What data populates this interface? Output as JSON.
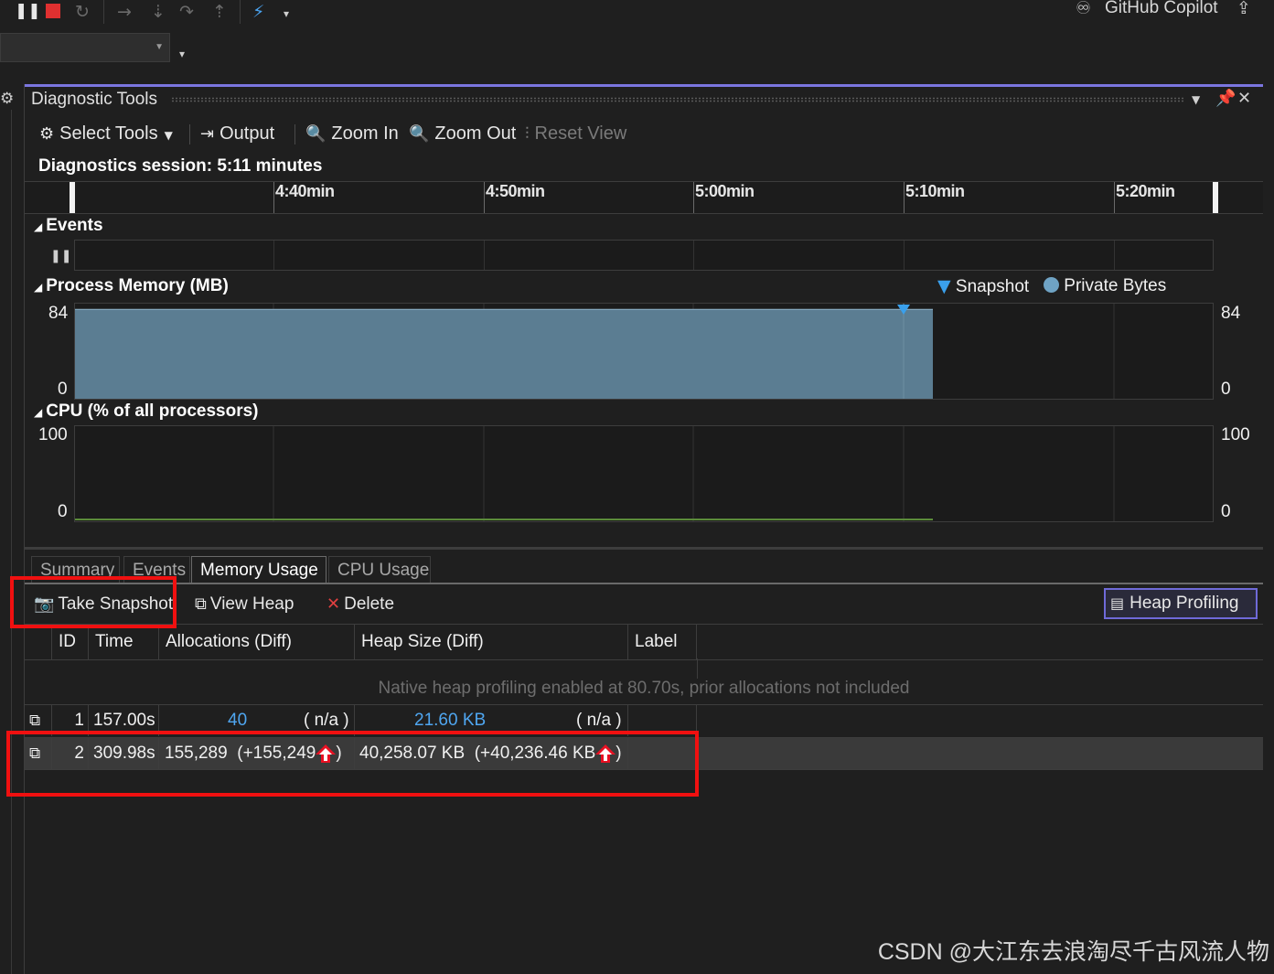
{
  "topbar": {
    "copilot_label": "GitHub Copilot",
    "icons": [
      "pause-icon",
      "stop-icon",
      "restart-icon",
      "step-over-icon",
      "step-into-icon",
      "step-back-icon",
      "step-out-icon",
      "hot-reload-icon",
      "dropdown-icon",
      "copilot-icon",
      "share-icon"
    ]
  },
  "panel": {
    "title": "Diagnostic Tools",
    "pin_glyph": "⊥",
    "close_glyph": "✕"
  },
  "toolbar": {
    "select_tools": "Select Tools",
    "output": "Output",
    "zoom_in": "Zoom In",
    "zoom_out": "Zoom Out",
    "reset_view": "Reset View"
  },
  "session": {
    "label": "Diagnostics session: 5:11 minutes"
  },
  "timeline": {
    "ticks": [
      "4:40min",
      "4:50min",
      "5:00min",
      "5:10min",
      "5:20min"
    ]
  },
  "events": {
    "heading": "Events"
  },
  "process_memory": {
    "heading": "Process Memory (MB)",
    "legend_snapshot": "Snapshot",
    "legend_private": "Private Bytes",
    "y_max": "84",
    "y_min": "0",
    "colors": {
      "private_bytes": "#5b7d92",
      "snapshot_marker": "#3aa0ec"
    }
  },
  "cpu": {
    "heading": "CPU (% of all processors)",
    "y_max": "100",
    "y_min": "0",
    "line_color": "#5b8c3a"
  },
  "chart_data": [
    {
      "type": "area",
      "title": "Process Memory (MB)",
      "series": [
        {
          "name": "Private Bytes",
          "values": [
            82,
            82
          ]
        }
      ],
      "x": [
        "4:31min",
        "5:11min"
      ],
      "ylim": [
        0,
        84
      ],
      "annotations": [
        {
          "type": "Snapshot",
          "x": "5:10min"
        }
      ]
    },
    {
      "type": "line",
      "title": "CPU (% of all processors)",
      "series": [
        {
          "name": "CPU",
          "values": [
            0,
            0
          ]
        }
      ],
      "x": [
        "4:31min",
        "5:11min"
      ],
      "ylim": [
        0,
        100
      ]
    }
  ],
  "tabs": [
    "Summary",
    "Events",
    "Memory Usage",
    "CPU Usage"
  ],
  "memory_toolbar": {
    "take_snapshot": "Take Snapshot",
    "view_heap": "View Heap",
    "delete": "Delete",
    "heap_profiling": "Heap Profiling"
  },
  "grid": {
    "headers": [
      "ID",
      "Time",
      "Allocations (Diff)",
      "Heap Size (Diff)",
      "Label"
    ],
    "native_note": "Native heap profiling enabled at 80.70s, prior allocations not included",
    "rows": [
      {
        "id": "1",
        "time": "157.00s",
        "alloc": "40",
        "alloc_diff": "( n/a )",
        "heap": "21.60 KB",
        "heap_diff": "( n/a )"
      },
      {
        "id": "2",
        "time": "309.98s",
        "alloc": "155,289",
        "alloc_diff": "(+155,249",
        "alloc_close": ")",
        "heap": "40,258.07 KB",
        "heap_diff": "(+40,236.46 KB",
        "heap_close": ")"
      }
    ]
  },
  "watermark": "CSDN @大江东去浪淘尽千古风流人物"
}
